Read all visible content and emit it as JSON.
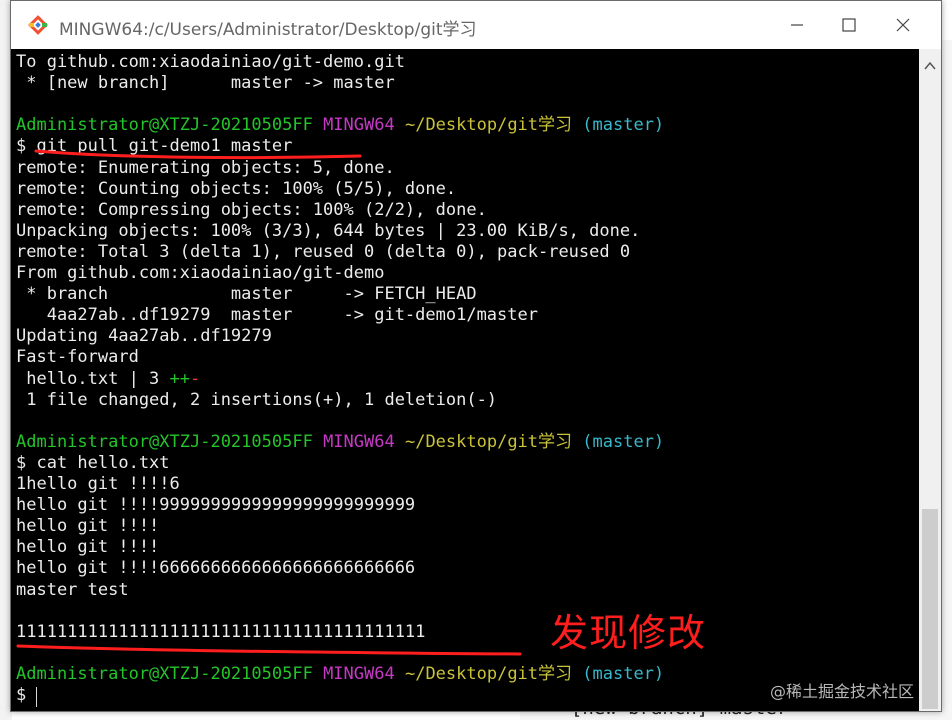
{
  "window": {
    "title": "MINGW64:/c/Users/Administrator/Desktop/git学习"
  },
  "terminal": {
    "lines": [
      {
        "text": "To github.com:xiaodainiao/git-demo.git"
      },
      {
        "text": " * [new branch]      master -> master"
      },
      {
        "text": ""
      },
      {
        "prompt": true,
        "user": "Administrator@XTZJ-20210505FF",
        "system": "MINGW64",
        "path": "~/Desktop/git学习",
        "branch": "(master)"
      },
      {
        "text": "$ git pull git-demo1 master"
      },
      {
        "text": "remote: Enumerating objects: 5, done."
      },
      {
        "text": "remote: Counting objects: 100% (5/5), done."
      },
      {
        "text": "remote: Compressing objects: 100% (2/2), done."
      },
      {
        "text": "Unpacking objects: 100% (3/3), 644 bytes | 23.00 KiB/s, done."
      },
      {
        "text": "remote: Total 3 (delta 1), reused 0 (delta 0), pack-reused 0"
      },
      {
        "text": "From github.com:xiaodainiao/git-demo"
      },
      {
        "text": " * branch            master     -> FETCH_HEAD"
      },
      {
        "text": "   4aa27ab..df19279  master     -> git-demo1/master"
      },
      {
        "text": "Updating 4aa27ab..df19279"
      },
      {
        "text": "Fast-forward"
      },
      {
        "diffstat": true,
        "text": " hello.txt | 3 ",
        "plus": "++",
        "minus": "-"
      },
      {
        "text": " 1 file changed, 2 insertions(+), 1 deletion(-)"
      },
      {
        "text": ""
      },
      {
        "prompt": true,
        "user": "Administrator@XTZJ-20210505FF",
        "system": "MINGW64",
        "path": "~/Desktop/git学习",
        "branch": "(master)"
      },
      {
        "text": "$ cat hello.txt"
      },
      {
        "text": "1hello git !!!!6"
      },
      {
        "text": "hello git !!!!9999999999999999999999999"
      },
      {
        "text": "hello git !!!!"
      },
      {
        "text": "hello git !!!!"
      },
      {
        "text": "hello git !!!!6666666666666666666666666"
      },
      {
        "text": "master test"
      },
      {
        "text": ""
      },
      {
        "text": "1111111111111111111111111111111111111111"
      },
      {
        "text": ""
      },
      {
        "prompt": true,
        "user": "Administrator@XTZJ-20210505FF",
        "system": "MINGW64",
        "path": "~/Desktop/git学习",
        "branch": "(master)"
      },
      {
        "text": "$ "
      }
    ]
  },
  "annotation": {
    "text": "发现修改"
  },
  "watermark": "@稀土掘金技术社区",
  "background": {
    "bottom_text": "* [new branch]      master"
  },
  "colors": {
    "prompt_user": "#23c52a",
    "prompt_system": "#c53ac5",
    "prompt_path": "#c9c23a",
    "prompt_branch": "#3ab7c9",
    "annotation": "#ff1e1e"
  }
}
